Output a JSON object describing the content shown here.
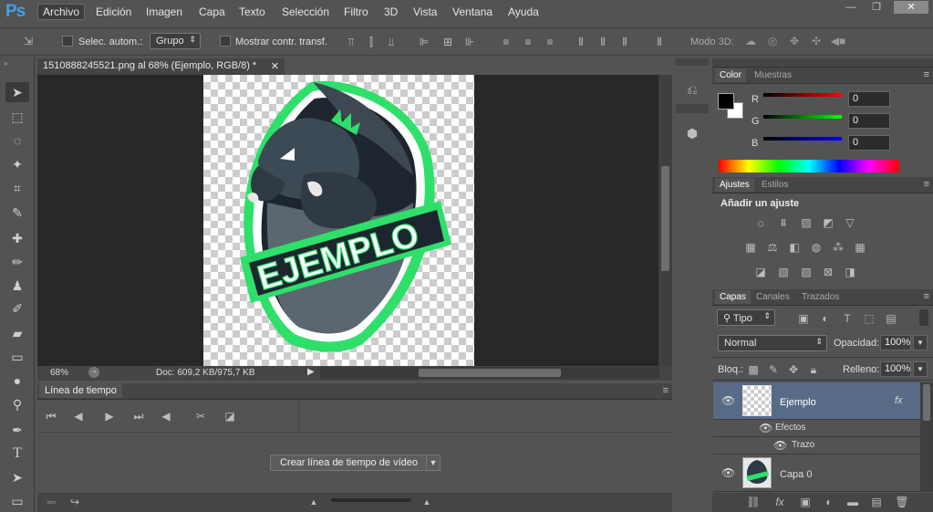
{
  "app": {
    "logo": "Ps"
  },
  "menu": [
    "Archivo",
    "Edición",
    "Imagen",
    "Capa",
    "Texto",
    "Selección",
    "Filtro",
    "3D",
    "Vista",
    "Ventana",
    "Ayuda"
  ],
  "window_buttons": [
    "—",
    "❐",
    "✕"
  ],
  "options": {
    "auto_select_label": "Selec. autom.:",
    "auto_select_value": "Grupo",
    "show_transform_label": "Mostrar contr. transf.",
    "mode3d_label": "Modo 3D:"
  },
  "document": {
    "tab_title": "1510888245521.png al 68% (Ejemplo, RGB/8) *",
    "zoom": "68%",
    "doc_info": "Doc: 609,2 KB/975,7 KB",
    "artwork_text": "EJEMPLO"
  },
  "timeline": {
    "title": "Línea de tiempo",
    "create_button": "Crear línea de tiempo de vídeo"
  },
  "color_panel": {
    "tabs": [
      "Color",
      "Muestras"
    ],
    "r_label": "R",
    "g_label": "G",
    "b_label": "B",
    "r_value": "0",
    "g_value": "0",
    "b_value": "0"
  },
  "adjust_panel": {
    "tabs": [
      "Ajustes",
      "Estilos"
    ],
    "heading": "Añadir un ajuste"
  },
  "layers_panel": {
    "tabs": [
      "Capas",
      "Canales",
      "Trazados"
    ],
    "filter_kind": "Tipo",
    "blend_mode": "Normal",
    "opacity_label": "Opacidad:",
    "opacity_value": "100%",
    "lock_label": "Bloq.:",
    "fill_label": "Relleno:",
    "fill_value": "100%",
    "layers": [
      {
        "name": "Ejemplo",
        "fx": "fx",
        "selected": true
      },
      {
        "name": "Capa 0",
        "selected": false
      }
    ],
    "effects_label": "Efectos",
    "stroke_label": "Trazo"
  },
  "colors": {
    "accent_green": "#2ee06a",
    "dragon_dark": "#2f3a44",
    "selection_blue": "#586b86"
  }
}
